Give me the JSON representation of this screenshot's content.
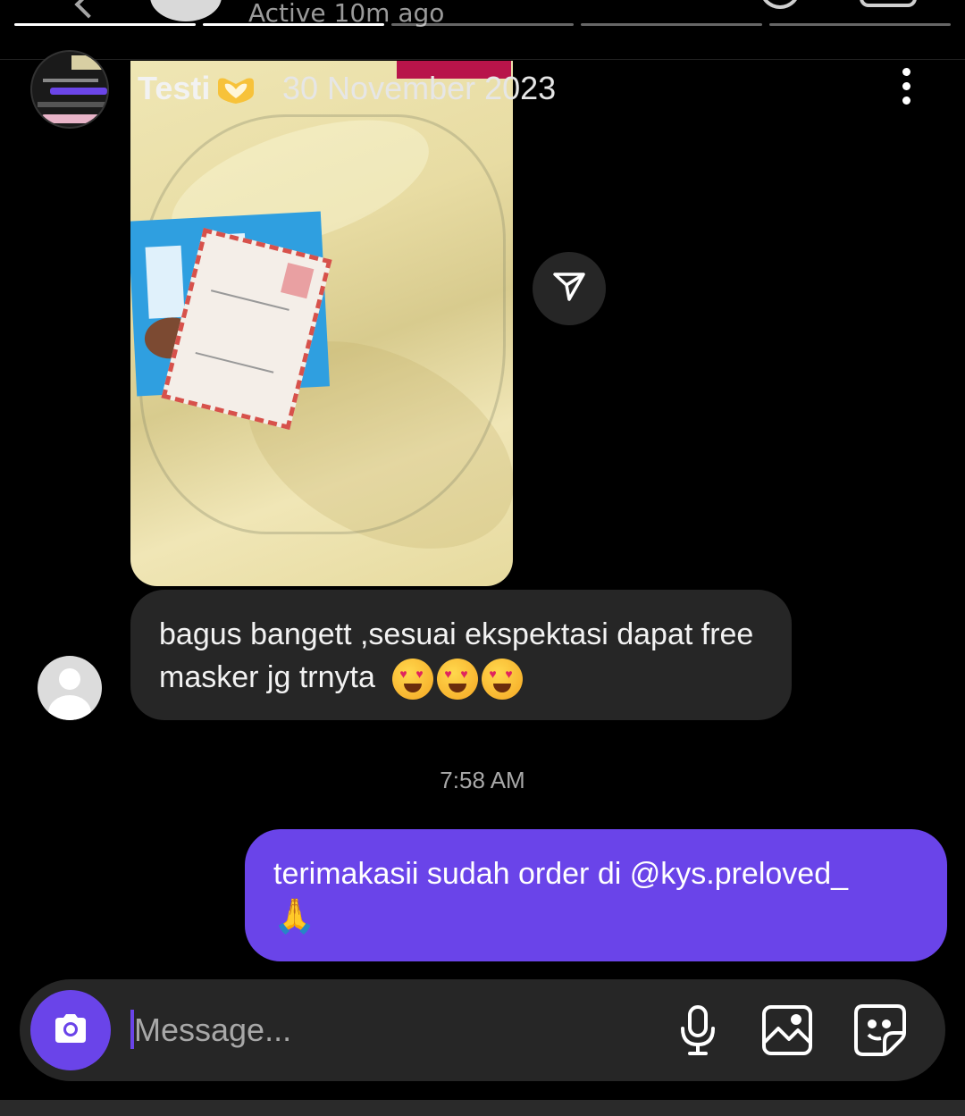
{
  "background_chat": {
    "status": "Active 10m ago"
  },
  "story": {
    "progress": [
      1,
      1,
      0,
      0,
      0
    ],
    "title": "Testi",
    "date": "30 November 2023"
  },
  "messages": {
    "incoming_text": "bagus bangett ,sesuai ekspektasi dapat free masker jg trnyta",
    "incoming_emojis": [
      "😍",
      "😍",
      "😍"
    ],
    "timestamp": "7:58 AM",
    "outgoing_text": "terimakasii sudah order di @kys.preloved_",
    "outgoing_emoji": "🙏"
  },
  "composer": {
    "placeholder": "Message..."
  },
  "colors": {
    "accent": "#6a44e9",
    "bubble_incoming": "#262626",
    "background": "#000000"
  },
  "icons": {
    "header": [
      "heart-hands-icon",
      "more-icon"
    ],
    "share": "send-icon",
    "composer": [
      "camera-icon",
      "microphone-icon",
      "gallery-icon",
      "sticker-icon"
    ]
  }
}
